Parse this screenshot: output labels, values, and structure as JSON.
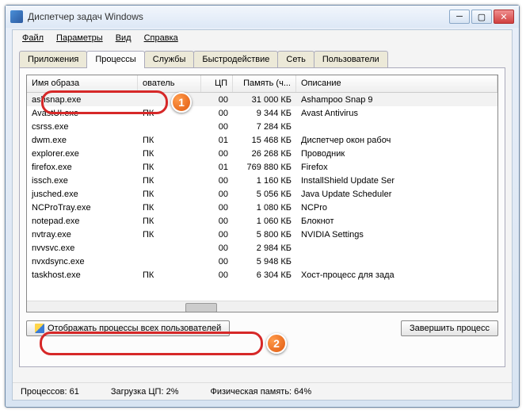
{
  "window": {
    "title": "Диспетчер задач Windows"
  },
  "menu": {
    "file": "Файл",
    "options": "Параметры",
    "view": "Вид",
    "help": "Справка"
  },
  "tabs": {
    "apps": "Приложения",
    "processes": "Процессы",
    "services": "Службы",
    "performance": "Быстродействие",
    "network": "Сеть",
    "users": "Пользователи"
  },
  "columns": {
    "image": "Имя образа",
    "user": "ователь",
    "cpu": "ЦП",
    "memory": "Память (ч...",
    "description": "Описание"
  },
  "rows": [
    {
      "img": "ashsnap.exe",
      "user": "",
      "cpu": "00",
      "mem": "31 000 КБ",
      "desc": "Ashampoo Snap 9"
    },
    {
      "img": "AvastUI.exe",
      "user": "ПК",
      "cpu": "00",
      "mem": "9 344 КБ",
      "desc": "Avast Antivirus"
    },
    {
      "img": "csrss.exe",
      "user": "",
      "cpu": "00",
      "mem": "7 284 КБ",
      "desc": ""
    },
    {
      "img": "dwm.exe",
      "user": "ПК",
      "cpu": "01",
      "mem": "15 468 КБ",
      "desc": "Диспетчер окон рабоч"
    },
    {
      "img": "explorer.exe",
      "user": "ПК",
      "cpu": "00",
      "mem": "26 268 КБ",
      "desc": "Проводник"
    },
    {
      "img": "firefox.exe",
      "user": "ПК",
      "cpu": "01",
      "mem": "769 880 КБ",
      "desc": "Firefox"
    },
    {
      "img": "issch.exe",
      "user": "ПК",
      "cpu": "00",
      "mem": "1 160 КБ",
      "desc": "InstallShield Update Ser"
    },
    {
      "img": "jusched.exe",
      "user": "ПК",
      "cpu": "00",
      "mem": "5 056 КБ",
      "desc": "Java Update Scheduler"
    },
    {
      "img": "NCProTray.exe",
      "user": "ПК",
      "cpu": "00",
      "mem": "1 080 КБ",
      "desc": "NCPro"
    },
    {
      "img": "notepad.exe",
      "user": "ПК",
      "cpu": "00",
      "mem": "1 060 КБ",
      "desc": "Блокнот"
    },
    {
      "img": "nvtray.exe",
      "user": "ПК",
      "cpu": "00",
      "mem": "5 800 КБ",
      "desc": "NVIDIA Settings"
    },
    {
      "img": "nvvsvc.exe",
      "user": "",
      "cpu": "00",
      "mem": "2 984 КБ",
      "desc": ""
    },
    {
      "img": "nvxdsync.exe",
      "user": "",
      "cpu": "00",
      "mem": "5 948 КБ",
      "desc": ""
    },
    {
      "img": "taskhost.exe",
      "user": "ПК",
      "cpu": "00",
      "mem": "6 304 КБ",
      "desc": "Хост-процесс для зада"
    }
  ],
  "buttons": {
    "show_all": "Отображать процессы всех пользователей",
    "end_process": "Завершить процесс"
  },
  "status": {
    "processes": "Процессов: 61",
    "cpu": "Загрузка ЦП: 2%",
    "memory": "Физическая память: 64%"
  },
  "badges": {
    "b1": "1",
    "b2": "2"
  }
}
